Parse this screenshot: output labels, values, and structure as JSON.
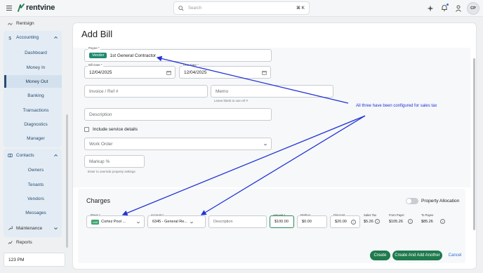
{
  "brand": {
    "name": "rentvine",
    "accent": "#1f7a4d",
    "annotation_color": "#2233d6"
  },
  "topbar": {
    "search_placeholder": "Search",
    "search_shortcut": "⌘ K",
    "avatar_initials": "CP",
    "icons": [
      "sparkle-icon",
      "bell-icon",
      "person-icon"
    ]
  },
  "sidebar": {
    "rentsign": "Rentsign",
    "accounting": {
      "label": "Accounting",
      "items": [
        "Dashboard",
        "Money In",
        "Money Out",
        "Banking",
        "Transactions",
        "Diagnostics",
        "Manager"
      ],
      "active": "Money Out"
    },
    "contacts": {
      "label": "Contacts",
      "items": [
        "Owners",
        "Tenants",
        "Vendors",
        "Messages"
      ]
    },
    "maintenance": "Maintenance",
    "reports": "Reports",
    "time": "123 PM"
  },
  "page": {
    "title": "Add Bill"
  },
  "form": {
    "payee": {
      "label": "Payee *",
      "badge": "Vendor",
      "value": "1st General Contractor"
    },
    "bill_date": {
      "label": "Bill Date *",
      "value": "12/04/2025"
    },
    "due_date": {
      "label": "Due Date *",
      "value": "12/04/2025"
    },
    "invoice": {
      "placeholder": "Invoice / Ref #"
    },
    "memo": {
      "placeholder": "Memo",
      "hint": "Leave blank to use ref #"
    },
    "description": {
      "placeholder": "Description"
    },
    "service_details": {
      "label": "Include service details",
      "checked": false
    },
    "work_order": {
      "placeholder": "Work Order"
    },
    "markup": {
      "placeholder": "Markup %",
      "hint": "Enter to override property settings"
    }
  },
  "charges": {
    "title": "Charges",
    "property_allocation": {
      "label": "Property Allocation",
      "enabled": false
    },
    "row": {
      "payer": {
        "label": "Payer *",
        "badge": "Unit",
        "value": "Cortez Pool ..."
      },
      "account": {
        "label": "Account *",
        "value": "6345 - General Re..."
      },
      "description": {
        "placeholder": "Description"
      },
      "amount": {
        "label": "Amount *",
        "value": "$100.00"
      },
      "markup": {
        "label": "Markup",
        "value": "$0.00"
      },
      "discount": {
        "label": "Discount",
        "value": "$20.00"
      },
      "sales_tax": {
        "label": "Sales Tax",
        "value": "$5.26"
      },
      "from_payer": {
        "label": "From Payer",
        "value": "$105.26"
      },
      "to_payee": {
        "label": "To Payee",
        "value": "$85.26"
      }
    }
  },
  "actions": {
    "create": "Create",
    "create_another": "Create And Add Another",
    "cancel": "Cancel"
  },
  "annotation": {
    "text": "All three have been configured for sales tax"
  }
}
